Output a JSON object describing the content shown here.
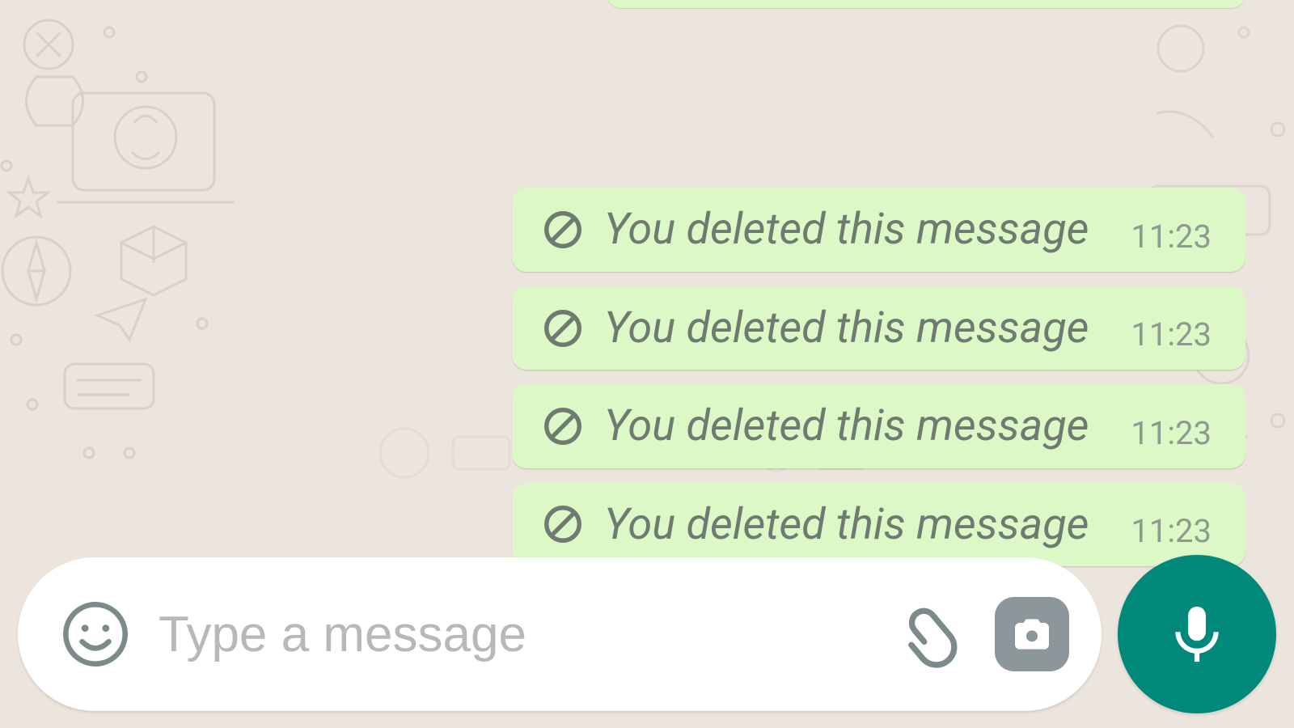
{
  "colors": {
    "bg": "#ece5dd",
    "bubble_out": "#dcf8c6",
    "bubble_shadow": "rgba(0,0,0,.12)",
    "text_muted": "#6f7b70",
    "text_time": "#8e9a8f",
    "input_bg": "#ffffff",
    "icon_gray": "#7d8a8c",
    "mic_bg": "#00897b",
    "mic_fg": "#ffffff",
    "overlay_stroke": "#c2bcb5"
  },
  "messages": [
    {
      "text": "You deleted this message",
      "time": "11:23"
    },
    {
      "text": "You deleted this message",
      "time": "11:23"
    },
    {
      "text": "You deleted this message",
      "time": "11:23"
    },
    {
      "text": "You deleted this message",
      "time": "11:23"
    }
  ],
  "composer": {
    "placeholder": "Type a message",
    "value": ""
  },
  "icons": {
    "prohibit": "prohibit-icon",
    "emoji": "emoji-icon",
    "attach": "attach-icon",
    "camera": "camera-icon",
    "mic": "mic-icon"
  }
}
